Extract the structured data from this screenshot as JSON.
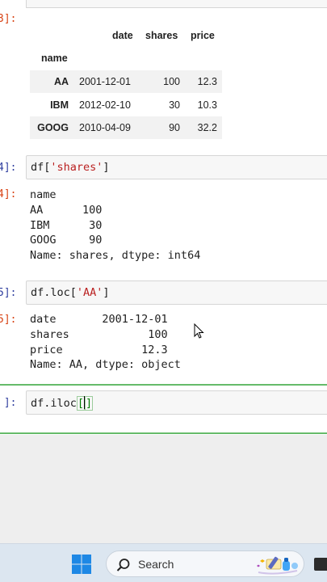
{
  "cells": [
    {
      "prompt": "3]:"
    },
    {
      "in_prompt": "4]:",
      "code": "df[",
      "code_str": "'shares'",
      "code_end": "]",
      "out_prompt": "4]:",
      "output_lines": [
        "name",
        "AA      100",
        "IBM      30",
        "GOOG     90",
        "Name: shares, dtype: int64"
      ]
    },
    {
      "in_prompt": "5]:",
      "code": "df.loc[",
      "code_str": "'AA'",
      "code_end": "]",
      "out_prompt": "5]:",
      "output_lines": [
        "date       2001-12-01",
        "shares            100",
        "price            12.3",
        "Name: AA, dtype: object"
      ]
    },
    {
      "in_prompt": " ]:",
      "code": "df.iloc",
      "bracket_open": "[",
      "bracket_close": "]"
    }
  ],
  "dataframe": {
    "columns": [
      "date",
      "shares",
      "price"
    ],
    "index_name": "name",
    "rows": [
      {
        "index": "AA",
        "date": "2001-12-01",
        "shares": "100",
        "price": "12.3"
      },
      {
        "index": "IBM",
        "date": "2012-02-10",
        "shares": "30",
        "price": "10.3"
      },
      {
        "index": "GOOG",
        "date": "2010-04-09",
        "shares": "90",
        "price": "32.2"
      }
    ]
  },
  "taskbar": {
    "search_label": "Search",
    "icons": [
      "windows-start-icon",
      "search-icon",
      "search-highlight-art",
      "taskbar-app-icon"
    ]
  },
  "colors": {
    "in_prompt": "#303f9f",
    "out_prompt": "#d84315",
    "string": "#ba2121",
    "active_cell_border": "#66bb6a",
    "taskbar": "#dce6f0"
  }
}
